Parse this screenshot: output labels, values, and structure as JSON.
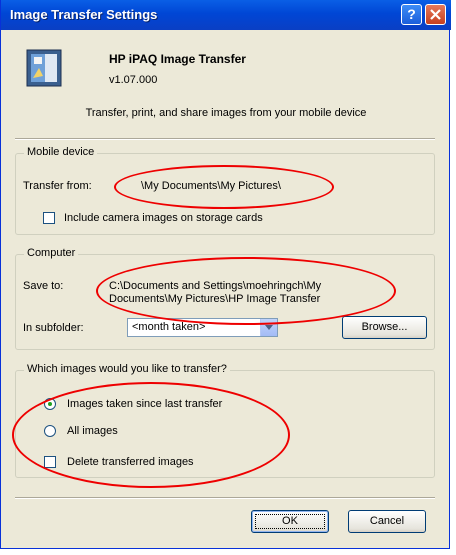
{
  "window": {
    "title": "Image Transfer Settings"
  },
  "header": {
    "app_name": "HP iPAQ Image Transfer",
    "version": "v1.07.000",
    "description": "Transfer, print, and share images from your mobile device"
  },
  "mobile_device": {
    "legend": "Mobile device",
    "transfer_from_label": "Transfer from:",
    "transfer_from_value": "\\My Documents\\My Pictures\\",
    "include_camera_label": "Include camera images on storage cards",
    "include_camera_checked": false
  },
  "computer": {
    "legend": "Computer",
    "save_to_label": "Save to:",
    "save_to_line1": "C:\\Documents and Settings\\moehringch\\My",
    "save_to_line2": "Documents\\My Pictures\\HP Image Transfer",
    "subfolder_label": "In subfolder:",
    "subfolder_value": "<month taken>",
    "browse_label": "Browse..."
  },
  "which_images": {
    "legend": "Which images would you like to transfer?",
    "option_since_last": "Images taken since last transfer",
    "option_all": "All images",
    "selected": "since_last",
    "delete_label": "Delete transferred images",
    "delete_checked": false
  },
  "buttons": {
    "ok": "OK",
    "cancel": "Cancel"
  },
  "colors": {
    "annotation": "#E00000",
    "titlebar": "#0046D5"
  }
}
